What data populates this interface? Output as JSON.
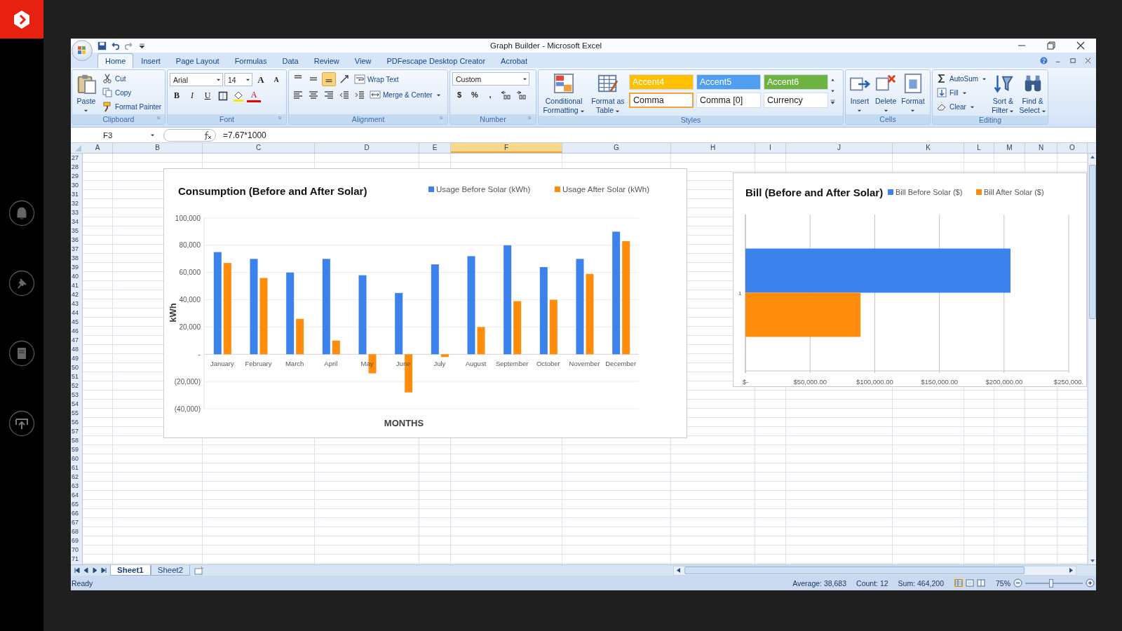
{
  "window": {
    "title": "Graph Builder - Microsoft Excel"
  },
  "ribbon_tabs": [
    {
      "label": "Home",
      "selected": true
    },
    {
      "label": "Insert",
      "selected": false
    },
    {
      "label": "Page Layout",
      "selected": false
    },
    {
      "label": "Formulas",
      "selected": false
    },
    {
      "label": "Data",
      "selected": false
    },
    {
      "label": "Review",
      "selected": false
    },
    {
      "label": "View",
      "selected": false
    },
    {
      "label": "PDFescape Desktop Creator",
      "selected": false
    },
    {
      "label": "Acrobat",
      "selected": false
    }
  ],
  "ribbon": [
    {
      "label": "Clipboard",
      "launcher": true,
      "items": [
        {
          "kind": "large",
          "label": "Paste",
          "dropdown": true
        },
        {
          "kind": "stack",
          "items": [
            {
              "kind": "small",
              "label": "Cut"
            },
            {
              "kind": "small",
              "label": "Copy"
            },
            {
              "kind": "small",
              "label": "Format Painter"
            }
          ]
        }
      ]
    },
    {
      "label": "Font",
      "launcher": true,
      "items": [
        {
          "kind": "stack",
          "items": [
            {
              "kind": "row",
              "items": [
                {
                  "kind": "combo",
                  "value": "Arial"
                },
                {
                  "kind": "combo",
                  "value": "14"
                },
                {
                  "kind": "letter",
                  "label": "A"
                },
                {
                  "kind": "letter",
                  "label": "A"
                }
              ]
            },
            {
              "kind": "row",
              "items": [
                {
                  "kind": "letter",
                  "label": "B"
                },
                {
                  "kind": "letter",
                  "label": "I"
                },
                {
                  "kind": "letter",
                  "label": "U"
                },
                {
                  "kind": "icon"
                },
                {
                  "kind": "icon"
                },
                {
                  "kind": "letter",
                  "label": "A"
                }
              ]
            }
          ]
        }
      ]
    },
    {
      "label": "Alignment",
      "launcher": true,
      "items": [
        {
          "kind": "stack",
          "items": [
            {
              "kind": "row",
              "items": [
                {
                  "kind": "toggle",
                  "selected": false
                },
                {
                  "kind": "toggle",
                  "selected": false
                },
                {
                  "kind": "toggle",
                  "selected": true
                },
                {
                  "kind": "icon"
                },
                {
                  "kind": "small",
                  "label": "Wrap Text"
                }
              ]
            },
            {
              "kind": "row",
              "items": [
                {
                  "kind": "toggle",
                  "selected": false
                },
                {
                  "kind": "toggle",
                  "selected": false
                },
                {
                  "kind": "toggle",
                  "selected": false
                },
                {
                  "kind": "icon"
                },
                {
                  "kind": "icon"
                },
                {
                  "kind": "small",
                  "label": "Merge & Center",
                  "dropdown": true
                }
              ]
            }
          ]
        }
      ]
    },
    {
      "label": "Number",
      "launcher": true,
      "items": [
        {
          "kind": "stack",
          "items": [
            {
              "kind": "row",
              "items": [
                {
                  "kind": "combo",
                  "value": "Custom"
                }
              ]
            },
            {
              "kind": "row",
              "items": [
                {
                  "kind": "letter",
                  "label": "$"
                },
                {
                  "kind": "letter",
                  "label": "%"
                },
                {
                  "kind": "letter",
                  "label": ","
                },
                {
                  "kind": "icon"
                },
                {
                  "kind": "icon"
                }
              ]
            }
          ]
        }
      ]
    },
    {
      "label": "Styles",
      "launcher": false,
      "items": [
        {
          "kind": "large",
          "label": "Conditional Formatting",
          "dropdown": true
        },
        {
          "kind": "large",
          "label": "Format as Table",
          "dropdown": true
        },
        {
          "kind": "gallery",
          "items": [
            {
              "label": "Accent4",
              "color": "#ffc000",
              "selected": false
            },
            {
              "label": "Accent5",
              "color": "#4f9ef0",
              "selected": false
            },
            {
              "label": "Accent6",
              "color": "#6eb33f",
              "selected": false
            },
            {
              "label": "Comma",
              "color": "#ffffff",
              "selected": true
            },
            {
              "label": "Comma [0]",
              "color": "#ffffff",
              "selected": false
            },
            {
              "label": "Currency",
              "color": "#ffffff",
              "selected": false
            }
          ]
        }
      ]
    },
    {
      "label": "Cells",
      "launcher": false,
      "items": [
        {
          "kind": "large",
          "label": "Insert",
          "dropdown": true
        },
        {
          "kind": "large",
          "label": "Delete",
          "dropdown": true
        },
        {
          "kind": "large",
          "label": "Format",
          "dropdown": true
        }
      ]
    },
    {
      "label": "Editing",
      "launcher": false,
      "items": [
        {
          "kind": "stack",
          "items": [
            {
              "kind": "small",
              "label": "AutoSum",
              "dropdown": true
            },
            {
              "kind": "small",
              "label": "Fill",
              "dropdown": true
            },
            {
              "kind": "small",
              "label": "Clear",
              "dropdown": true
            }
          ]
        },
        {
          "kind": "large",
          "label": "Sort & Filter",
          "dropdown": true
        },
        {
          "kind": "large",
          "label": "Find & Select",
          "dropdown": true
        }
      ]
    }
  ],
  "formula_bar": {
    "name_box": "F3",
    "formula": "=7.67*1000"
  },
  "columns": [
    {
      "label": "A",
      "selected": false
    },
    {
      "label": "B",
      "selected": false
    },
    {
      "label": "C",
      "selected": false
    },
    {
      "label": "D",
      "selected": false
    },
    {
      "label": "E",
      "selected": false
    },
    {
      "label": "F",
      "selected": true
    },
    {
      "label": "G",
      "selected": false
    },
    {
      "label": "H",
      "selected": false
    },
    {
      "label": "I",
      "selected": false
    },
    {
      "label": "J",
      "selected": false
    },
    {
      "label": "K",
      "selected": false
    },
    {
      "label": "L",
      "selected": false
    },
    {
      "label": "M",
      "selected": false
    },
    {
      "label": "N",
      "selected": false
    },
    {
      "label": "O",
      "selected": false
    }
  ],
  "rows": [
    "27",
    "28",
    "29",
    "30",
    "31",
    "32",
    "33",
    "34",
    "35",
    "36",
    "37",
    "38",
    "39",
    "40",
    "41",
    "42",
    "43",
    "44",
    "45",
    "46",
    "47",
    "48",
    "49",
    "50",
    "51",
    "52",
    "53",
    "54",
    "55",
    "56",
    "57",
    "58",
    "59",
    "60",
    "61",
    "62",
    "63",
    "64",
    "65",
    "66",
    "67",
    "68",
    "69",
    "70",
    "71"
  ],
  "charts": [
    {
      "chart_data": {
        "type": "bar",
        "title": "Consumption (Before and After Solar)",
        "xlabel": "MONTHS",
        "ylabel": "kWh",
        "categories": [
          "January",
          "February",
          "March",
          "April",
          "May",
          "June",
          "July",
          "August",
          "September",
          "October",
          "November",
          "December"
        ],
        "series": [
          {
            "name": "Usage Before Solar (kWh)",
            "color": "#3b82ec",
            "values": [
              75000,
              70000,
              60000,
              70000,
              58000,
              45000,
              66000,
              72000,
              80000,
              64000,
              70000,
              90000
            ]
          },
          {
            "name": "Usage After Solar (kWh)",
            "color": "#ff8c0a",
            "values": [
              67000,
              56000,
              26000,
              10000,
              -14000,
              -28000,
              -2000,
              20000,
              39000,
              40000,
              59000,
              83000
            ]
          }
        ],
        "grid": true,
        "legend": "top-right",
        "ylim": [
          -40000,
          100000
        ],
        "yticks": [
          {
            "value": -40000,
            "label": "(40,000)"
          },
          {
            "value": -20000,
            "label": "(20,000)"
          },
          {
            "value": 0,
            "label": "-"
          },
          {
            "value": 20000,
            "label": "20,000"
          },
          {
            "value": 40000,
            "label": "40,000"
          },
          {
            "value": 60000,
            "label": "60,000"
          },
          {
            "value": 80000,
            "label": "80,000"
          },
          {
            "value": 100000,
            "label": "100,000"
          }
        ]
      }
    },
    {
      "chart_data": {
        "type": "bar",
        "orientation": "horizontal",
        "title": "Bill (Before and After Solar)",
        "categories": [
          "1"
        ],
        "series": [
          {
            "name": "Bill Before Solar ($)",
            "color": "#3b82ec",
            "values": [
              205000
            ]
          },
          {
            "name": "Bill After Solar ($)",
            "color": "#ff8c0a",
            "values": [
              89000
            ]
          }
        ],
        "grid": true,
        "legend": "top-right",
        "xlim": [
          0,
          250000
        ],
        "xticks": [
          {
            "value": 0,
            "label": "$-"
          },
          {
            "value": 50000,
            "label": "$50,000.00"
          },
          {
            "value": 100000,
            "label": "$100,000.00"
          },
          {
            "value": 150000,
            "label": "$150,000.00"
          },
          {
            "value": 200000,
            "label": "$200,000.00"
          },
          {
            "value": 250000,
            "label": "$250,000."
          }
        ]
      }
    }
  ],
  "sheet_tabs": [
    {
      "label": "Sheet1",
      "selected": true
    },
    {
      "label": "Sheet2",
      "selected": false
    }
  ],
  "status_bar": {
    "status": "Ready",
    "average": "Average: 38,683",
    "count": "Count: 12",
    "sum": "Sum: 464,200",
    "zoom": "75%",
    "zoom_slider": {
      "level": 0.45
    }
  }
}
